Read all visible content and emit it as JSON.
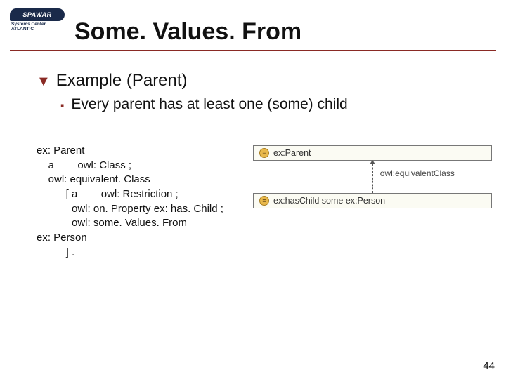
{
  "logo": {
    "word": "SPAWAR",
    "sub1": "Systems Center",
    "sub2": "ATLANTIC"
  },
  "title": "Some. Values. From",
  "bullets": {
    "l1": "Example (Parent)",
    "l2": "Every parent has at least one (some) child"
  },
  "code": {
    "line1": "ex: Parent",
    "line2": "    a        owl: Class ;",
    "line3": "    owl: equivalent. Class",
    "line4": "          [ a        owl: Restriction ;",
    "line5": "            owl: on. Property ex: has. Child ;",
    "line6": "            owl: some. Values. From",
    "line7": "ex: Person",
    "line8": "          ] ."
  },
  "diagram": {
    "top_label": "ex:Parent",
    "edge_label": "owl:equivalentClass",
    "bottom_label": "ex:hasChild some ex:Person",
    "circle_glyph": "≡"
  },
  "page_number": "44"
}
